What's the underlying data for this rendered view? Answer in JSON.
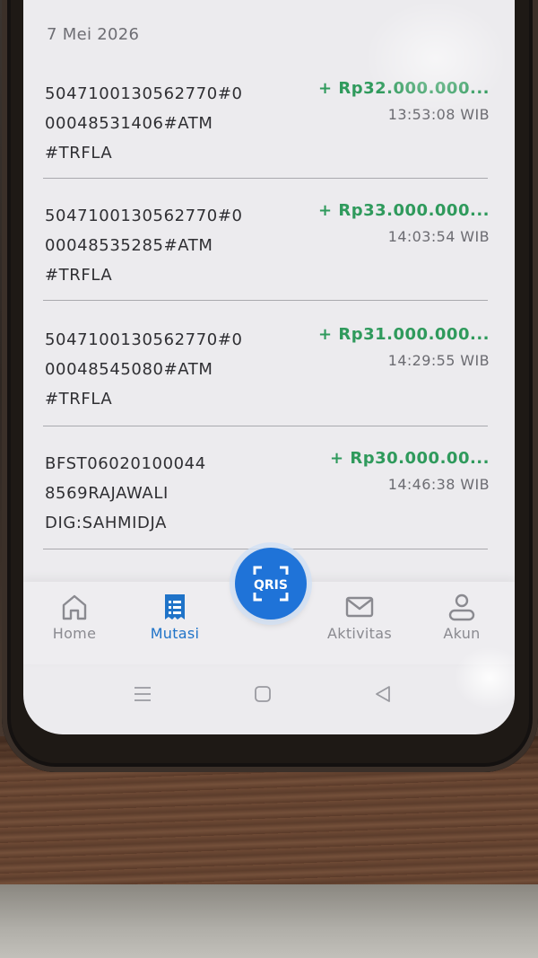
{
  "date_header": "7 Mei 2026",
  "transactions": [
    {
      "description": "5047100130562770#000048531406#ATM#TRFLA",
      "desc_lines": [
        "5047100130562770#0",
        "00048531406#ATM",
        "#TRFLA"
      ],
      "amount": "+ Rp32.000.000...",
      "time": "13:53:08 WIB"
    },
    {
      "description": "5047100130562770#000048535285#ATM#TRFLA",
      "desc_lines": [
        "5047100130562770#0",
        "00048535285#ATM",
        "#TRFLA"
      ],
      "amount": "+ Rp33.000.000...",
      "time": "14:03:54 WIB"
    },
    {
      "description": "5047100130562770#000048545080#ATM#TRFLA",
      "desc_lines": [
        "5047100130562770#0",
        "00048545080#ATM",
        "#TRFLA"
      ],
      "amount": "+ Rp31.000.000...",
      "time": "14:29:55 WIB"
    },
    {
      "description": "BFST060201000448569RAJAWALI DIG:SAHMIDJA",
      "desc_lines": [
        "BFST06020100044",
        "8569RAJAWALI",
        "DIG:SAHMIDJA"
      ],
      "amount": "+ Rp30.000.00...",
      "time": "14:46:38 WIB"
    }
  ],
  "bottom_nav": {
    "items": [
      {
        "label": "Home",
        "icon": "home-icon",
        "active": false
      },
      {
        "label": "Mutasi",
        "icon": "receipt-list-icon",
        "active": true
      },
      {
        "label": "Aktivitas",
        "icon": "mail-icon",
        "active": false
      },
      {
        "label": "Akun",
        "icon": "user-icon",
        "active": false
      }
    ],
    "center_button": {
      "label": "QRIS",
      "icon": "qris-scan-icon"
    }
  },
  "colors": {
    "amount_credit": "#2f9a5c",
    "accent": "#1f73d8",
    "screen_bg": "#ecebee"
  }
}
